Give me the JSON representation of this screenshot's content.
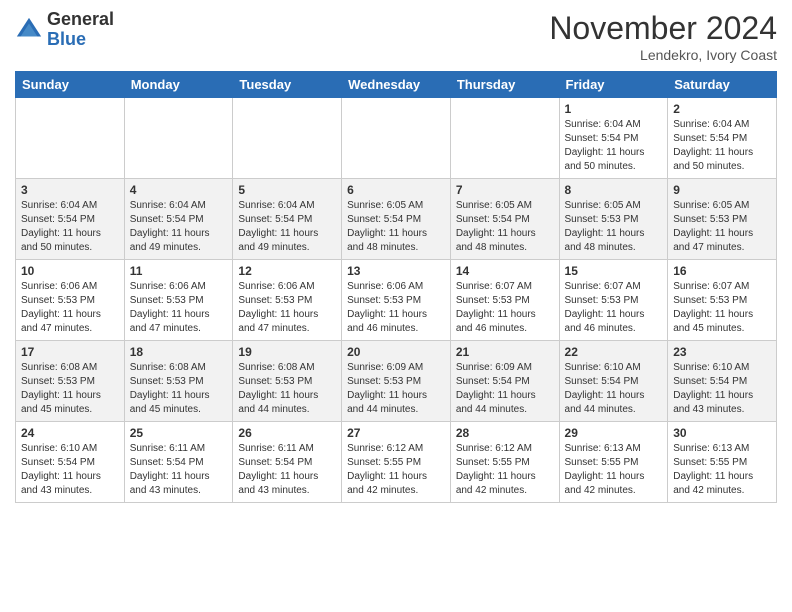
{
  "header": {
    "logo_general": "General",
    "logo_blue": "Blue",
    "month_title": "November 2024",
    "location": "Lendekro, Ivory Coast"
  },
  "weekdays": [
    "Sunday",
    "Monday",
    "Tuesday",
    "Wednesday",
    "Thursday",
    "Friday",
    "Saturday"
  ],
  "weeks": [
    [
      {
        "day": "",
        "info": ""
      },
      {
        "day": "",
        "info": ""
      },
      {
        "day": "",
        "info": ""
      },
      {
        "day": "",
        "info": ""
      },
      {
        "day": "",
        "info": ""
      },
      {
        "day": "1",
        "info": "Sunrise: 6:04 AM\nSunset: 5:54 PM\nDaylight: 11 hours and 50 minutes."
      },
      {
        "day": "2",
        "info": "Sunrise: 6:04 AM\nSunset: 5:54 PM\nDaylight: 11 hours and 50 minutes."
      }
    ],
    [
      {
        "day": "3",
        "info": "Sunrise: 6:04 AM\nSunset: 5:54 PM\nDaylight: 11 hours and 50 minutes."
      },
      {
        "day": "4",
        "info": "Sunrise: 6:04 AM\nSunset: 5:54 PM\nDaylight: 11 hours and 49 minutes."
      },
      {
        "day": "5",
        "info": "Sunrise: 6:04 AM\nSunset: 5:54 PM\nDaylight: 11 hours and 49 minutes."
      },
      {
        "day": "6",
        "info": "Sunrise: 6:05 AM\nSunset: 5:54 PM\nDaylight: 11 hours and 48 minutes."
      },
      {
        "day": "7",
        "info": "Sunrise: 6:05 AM\nSunset: 5:54 PM\nDaylight: 11 hours and 48 minutes."
      },
      {
        "day": "8",
        "info": "Sunrise: 6:05 AM\nSunset: 5:53 PM\nDaylight: 11 hours and 48 minutes."
      },
      {
        "day": "9",
        "info": "Sunrise: 6:05 AM\nSunset: 5:53 PM\nDaylight: 11 hours and 47 minutes."
      }
    ],
    [
      {
        "day": "10",
        "info": "Sunrise: 6:06 AM\nSunset: 5:53 PM\nDaylight: 11 hours and 47 minutes."
      },
      {
        "day": "11",
        "info": "Sunrise: 6:06 AM\nSunset: 5:53 PM\nDaylight: 11 hours and 47 minutes."
      },
      {
        "day": "12",
        "info": "Sunrise: 6:06 AM\nSunset: 5:53 PM\nDaylight: 11 hours and 47 minutes."
      },
      {
        "day": "13",
        "info": "Sunrise: 6:06 AM\nSunset: 5:53 PM\nDaylight: 11 hours and 46 minutes."
      },
      {
        "day": "14",
        "info": "Sunrise: 6:07 AM\nSunset: 5:53 PM\nDaylight: 11 hours and 46 minutes."
      },
      {
        "day": "15",
        "info": "Sunrise: 6:07 AM\nSunset: 5:53 PM\nDaylight: 11 hours and 46 minutes."
      },
      {
        "day": "16",
        "info": "Sunrise: 6:07 AM\nSunset: 5:53 PM\nDaylight: 11 hours and 45 minutes."
      }
    ],
    [
      {
        "day": "17",
        "info": "Sunrise: 6:08 AM\nSunset: 5:53 PM\nDaylight: 11 hours and 45 minutes."
      },
      {
        "day": "18",
        "info": "Sunrise: 6:08 AM\nSunset: 5:53 PM\nDaylight: 11 hours and 45 minutes."
      },
      {
        "day": "19",
        "info": "Sunrise: 6:08 AM\nSunset: 5:53 PM\nDaylight: 11 hours and 44 minutes."
      },
      {
        "day": "20",
        "info": "Sunrise: 6:09 AM\nSunset: 5:53 PM\nDaylight: 11 hours and 44 minutes."
      },
      {
        "day": "21",
        "info": "Sunrise: 6:09 AM\nSunset: 5:54 PM\nDaylight: 11 hours and 44 minutes."
      },
      {
        "day": "22",
        "info": "Sunrise: 6:10 AM\nSunset: 5:54 PM\nDaylight: 11 hours and 44 minutes."
      },
      {
        "day": "23",
        "info": "Sunrise: 6:10 AM\nSunset: 5:54 PM\nDaylight: 11 hours and 43 minutes."
      }
    ],
    [
      {
        "day": "24",
        "info": "Sunrise: 6:10 AM\nSunset: 5:54 PM\nDaylight: 11 hours and 43 minutes."
      },
      {
        "day": "25",
        "info": "Sunrise: 6:11 AM\nSunset: 5:54 PM\nDaylight: 11 hours and 43 minutes."
      },
      {
        "day": "26",
        "info": "Sunrise: 6:11 AM\nSunset: 5:54 PM\nDaylight: 11 hours and 43 minutes."
      },
      {
        "day": "27",
        "info": "Sunrise: 6:12 AM\nSunset: 5:55 PM\nDaylight: 11 hours and 42 minutes."
      },
      {
        "day": "28",
        "info": "Sunrise: 6:12 AM\nSunset: 5:55 PM\nDaylight: 11 hours and 42 minutes."
      },
      {
        "day": "29",
        "info": "Sunrise: 6:13 AM\nSunset: 5:55 PM\nDaylight: 11 hours and 42 minutes."
      },
      {
        "day": "30",
        "info": "Sunrise: 6:13 AM\nSunset: 5:55 PM\nDaylight: 11 hours and 42 minutes."
      }
    ]
  ]
}
